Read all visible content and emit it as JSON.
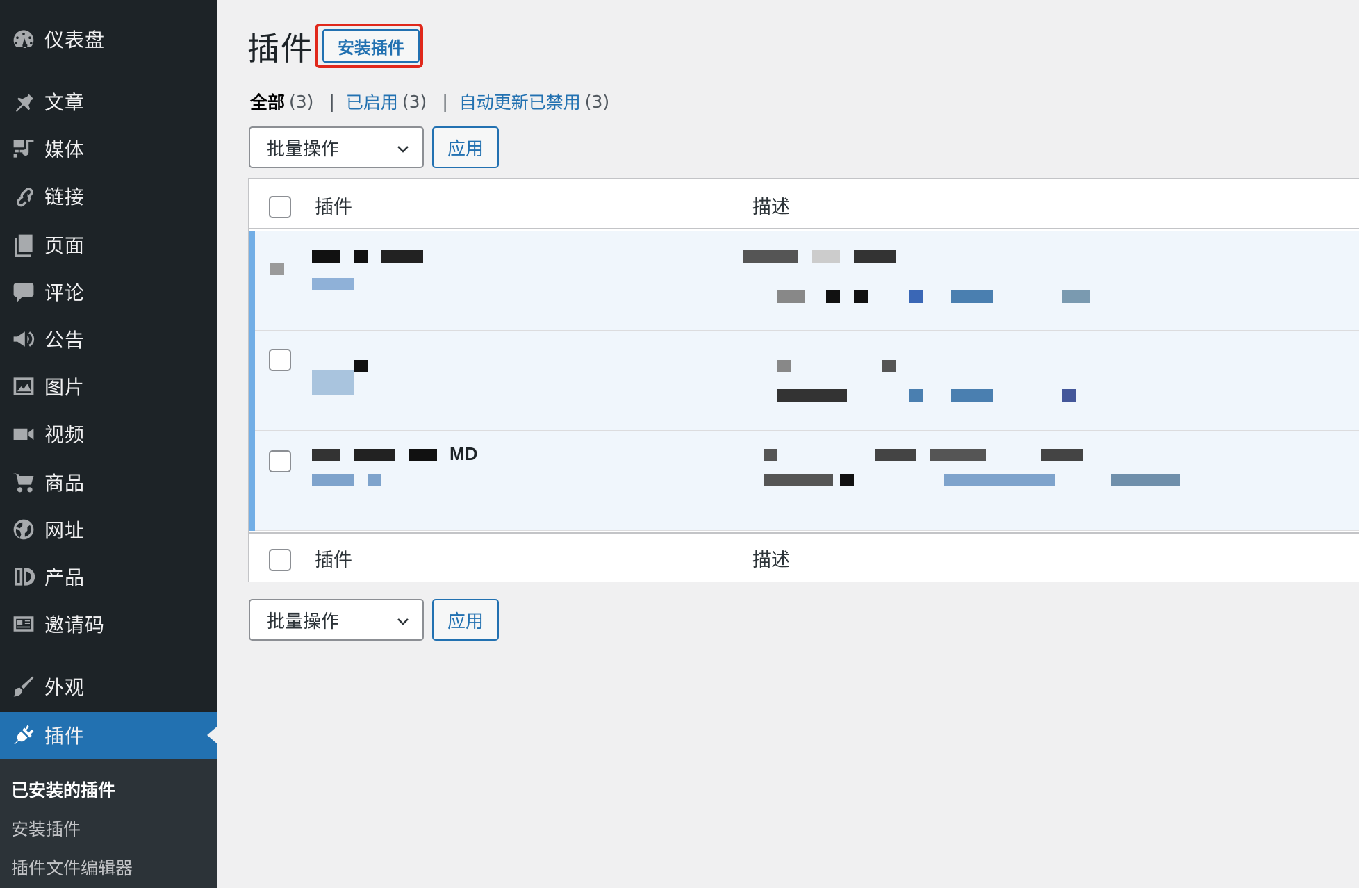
{
  "sidebar": {
    "items": [
      {
        "label": "仪表盘",
        "icon": "dashboard-icon"
      },
      {
        "label": "文章",
        "icon": "pin-icon"
      },
      {
        "label": "媒体",
        "icon": "media-icon"
      },
      {
        "label": "链接",
        "icon": "link-icon"
      },
      {
        "label": "页面",
        "icon": "page-icon"
      },
      {
        "label": "评论",
        "icon": "comment-icon"
      },
      {
        "label": "公告",
        "icon": "megaphone-icon"
      },
      {
        "label": "图片",
        "icon": "image-icon"
      },
      {
        "label": "视频",
        "icon": "video-icon"
      },
      {
        "label": "商品",
        "icon": "cart-icon"
      },
      {
        "label": "网址",
        "icon": "globe-icon"
      },
      {
        "label": "产品",
        "icon": "product-icon"
      },
      {
        "label": "邀请码",
        "icon": "id-card-icon"
      },
      {
        "label": "外观",
        "icon": "brush-icon"
      },
      {
        "label": "插件",
        "icon": "plug-icon",
        "active": true
      }
    ],
    "submenu": [
      {
        "label": "已安装的插件",
        "current": true
      },
      {
        "label": "安装插件"
      },
      {
        "label": "插件文件编辑器"
      }
    ]
  },
  "header": {
    "title": "插件",
    "add_new": "安装插件"
  },
  "filters": {
    "all": {
      "label": "全部",
      "count": "(3)"
    },
    "active": {
      "label": "已启用",
      "count": "(3)"
    },
    "autoupdate_disabled": {
      "label": "自动更新已禁用",
      "count": "(3)"
    },
    "separator": "|"
  },
  "bulk": {
    "select_label": "批量操作",
    "apply_label": "应用"
  },
  "table": {
    "columns": {
      "name": "插件",
      "description": "描述"
    },
    "rows": [
      {
        "name_visible": ""
      },
      {
        "name_visible": ""
      },
      {
        "name_visible": "MD"
      }
    ]
  },
  "colors": {
    "sidebar_bg": "#1d2327",
    "submenu_bg": "#2c3338",
    "accent": "#2271b1",
    "row_bg": "#f0f6fc",
    "active_stripe": "#72aee6",
    "highlight": "#e0281b"
  }
}
